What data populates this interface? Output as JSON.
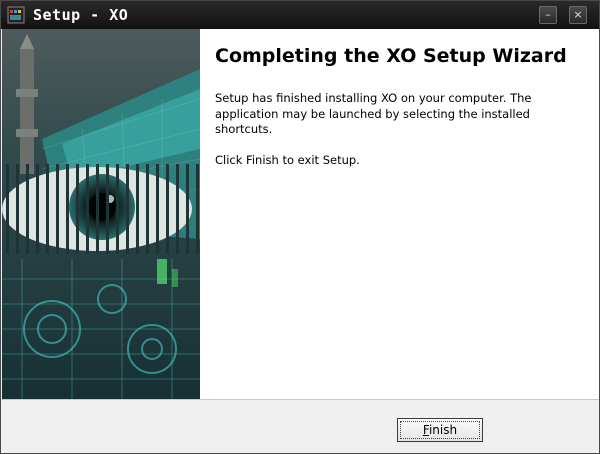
{
  "window": {
    "title": "Setup - XO"
  },
  "title_buttons": {
    "minimize_glyph": "–",
    "close_glyph": "×"
  },
  "main": {
    "heading": "Completing the XO Setup Wizard",
    "paragraph1": "Setup has finished installing XO on your computer. The application may be launched by selecting the installed shortcuts.",
    "paragraph2": "Click Finish to exit Setup."
  },
  "footer": {
    "finish_label_mnemonic": "F",
    "finish_label_rest": "inish"
  },
  "icons": {
    "app_icon": "setup-app-icon",
    "banner": "eye-banner-image"
  },
  "colors": {
    "titlebar": "#1a1a1a",
    "banner_teal": "#3fb6b0",
    "content_bg": "#ffffff",
    "footer_bg": "#f0f0f0"
  }
}
